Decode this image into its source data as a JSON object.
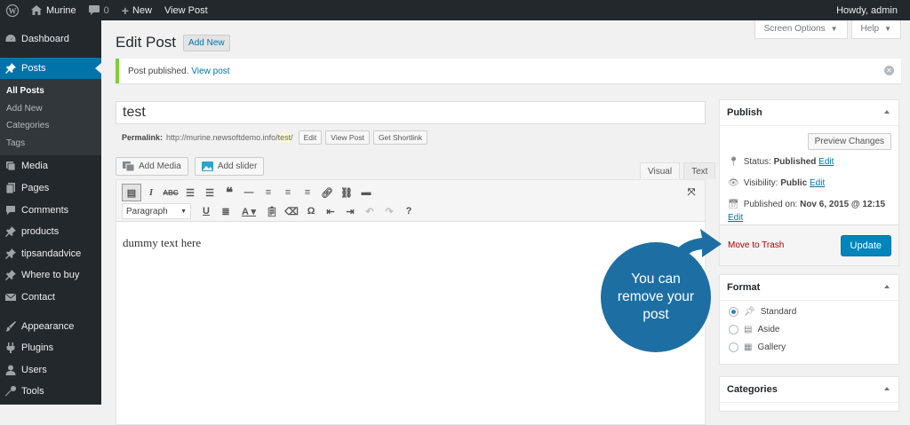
{
  "adminbar": {
    "site_name": "Murine",
    "comments_count": "0",
    "new_label": "New",
    "view_post_label": "View Post",
    "howdy": "Howdy, admin"
  },
  "sidebar": {
    "items": [
      {
        "label": "Dashboard",
        "icon": "dashboard-icon"
      },
      {
        "label": "Posts",
        "icon": "pin-icon"
      },
      {
        "label": "Media",
        "icon": "media-icon"
      },
      {
        "label": "Pages",
        "icon": "pages-icon"
      },
      {
        "label": "Comments",
        "icon": "comments-icon"
      },
      {
        "label": "products",
        "icon": "pin-icon"
      },
      {
        "label": "tipsandadvice",
        "icon": "pin-icon"
      },
      {
        "label": "Where to buy",
        "icon": "pin-icon"
      },
      {
        "label": "Contact",
        "icon": "mail-icon"
      },
      {
        "label": "Appearance",
        "icon": "brush-icon"
      },
      {
        "label": "Plugins",
        "icon": "plugin-icon"
      },
      {
        "label": "Users",
        "icon": "user-icon"
      },
      {
        "label": "Tools",
        "icon": "wrench-icon"
      }
    ],
    "submenu": [
      "All Posts",
      "Add New",
      "Categories",
      "Tags"
    ]
  },
  "header": {
    "screen_options": "Screen Options",
    "help": "Help",
    "title": "Edit Post",
    "add_new": "Add New"
  },
  "notice": {
    "text": "Post published.",
    "link": "View post"
  },
  "post": {
    "title": "test",
    "permalink_label": "Permalink:",
    "permalink_base": "http://murine.newsoftdemo.info/",
    "permalink_slug": "test",
    "permalink_end": "/",
    "edit_btn": "Edit",
    "view_btn": "View Post",
    "shortlink_btn": "Get Shortlink",
    "content": "dummy text here"
  },
  "editor": {
    "add_media": "Add Media",
    "add_slider": "Add slider",
    "tab_visual": "Visual",
    "tab_text": "Text",
    "format_select": "Paragraph"
  },
  "publish": {
    "title": "Publish",
    "preview": "Preview Changes",
    "status_label": "Status:",
    "status_value": "Published",
    "visibility_label": "Visibility:",
    "visibility_value": "Public",
    "published_label": "Published on:",
    "published_value": "Nov 6, 2015 @ 12:15",
    "edit": "Edit",
    "trash": "Move to Trash",
    "update": "Update"
  },
  "format": {
    "title": "Format",
    "options": [
      "Standard",
      "Aside",
      "Gallery"
    ],
    "selected": "Standard"
  },
  "categories": {
    "title": "Categories"
  },
  "callout": {
    "line1": "You can",
    "line2": "remove your",
    "line3": "post"
  },
  "colors": {
    "admin_bar": "#23282d",
    "active_menu": "#0073aa",
    "notice_border": "#7ad03a",
    "update_button": "#0085ba",
    "trash_link": "#aa0000",
    "callout": "#1d6fa3"
  }
}
